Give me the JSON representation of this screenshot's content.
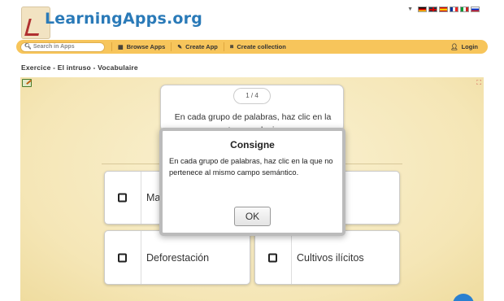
{
  "header": {
    "logo_text": "LearningApps.org",
    "languages": [
      "German",
      "English",
      "Spanish",
      "French",
      "Italian",
      "Russian"
    ]
  },
  "nav": {
    "search_placeholder": "Search in Apps",
    "browse_label": "Browse Apps",
    "create_label": "Create App",
    "collection_label": "Create collection",
    "login_label": "Login"
  },
  "page": {
    "title": "Exercice - El intruso - Vocabulaire"
  },
  "app": {
    "pager": "1 / 4",
    "intro_text": "En cada grupo de palabras, haz clic en la que no pertenece al mismo campo semántico.",
    "options": [
      {
        "label": "Ma"
      },
      {
        "label": ""
      },
      {
        "label": "Deforestación"
      },
      {
        "label": "Cultivos ilícitos"
      }
    ]
  },
  "dialog": {
    "title": "Consigne",
    "body": "En cada grupo de palabras, haz clic en la que no pertenece al mismo campo semántico.",
    "ok_label": "OK"
  },
  "colors": {
    "navbar": "#f7c55b",
    "logo": "#2a7ab8",
    "app_bg": "#f6e9bd",
    "help": "#2a80d0"
  }
}
